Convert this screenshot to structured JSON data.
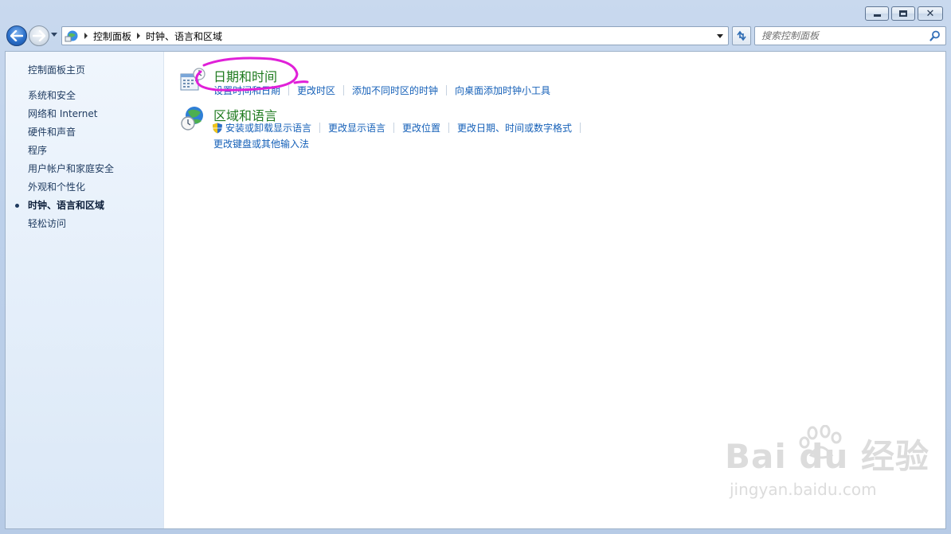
{
  "window": {
    "caption": {
      "minimize": "minimize",
      "maximize": "maximize",
      "close": "close"
    }
  },
  "nav": {
    "breadcrumb": [
      "控制面板",
      "时钟、语言和区域"
    ],
    "search_placeholder": "搜索控制面板"
  },
  "sidebar": {
    "home": "控制面板主页",
    "items": [
      {
        "label": "系统和安全",
        "current": false
      },
      {
        "label": "网络和 Internet",
        "current": false
      },
      {
        "label": "硬件和声音",
        "current": false
      },
      {
        "label": "程序",
        "current": false
      },
      {
        "label": "用户帐户和家庭安全",
        "current": false
      },
      {
        "label": "外观和个性化",
        "current": false
      },
      {
        "label": "时钟、语言和区域",
        "current": true
      },
      {
        "label": "轻松访问",
        "current": false
      }
    ]
  },
  "categories": [
    {
      "title": "日期和时间",
      "icon": "calendar-clock-icon",
      "links": [
        "设置时间和日期",
        "更改时区",
        "添加不同时区的时钟",
        "向桌面添加时钟小工具"
      ]
    },
    {
      "title": "区域和语言",
      "icon": "globe-clock-icon",
      "links": [
        "安装或卸载显示语言",
        "更改显示语言",
        "更改位置",
        "更改日期、时间或数字格式"
      ],
      "links2": [
        "更改键盘或其他输入法"
      ]
    }
  ],
  "annotation": {
    "color": "#e020d8"
  },
  "watermark": {
    "brand": "Bai du 经验",
    "url": "jingyan.baidu.com"
  },
  "colors": {
    "title_green": "#1e7a1e",
    "link_blue": "#1560b8"
  }
}
